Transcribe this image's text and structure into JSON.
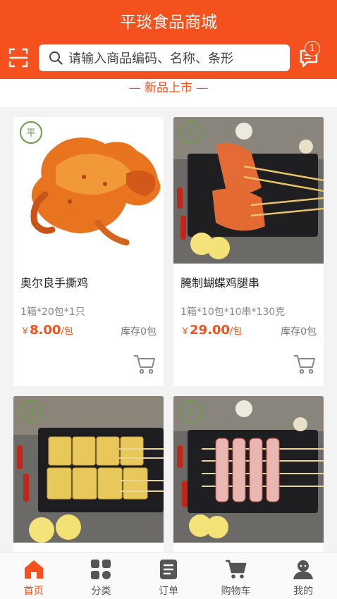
{
  "header": {
    "title": "平琰食品商城",
    "message_badge": "1"
  },
  "search": {
    "placeholder": "请输入商品编码、名称、条形"
  },
  "section": {
    "title": "— 新品上市 —"
  },
  "products": [
    {
      "name": "奥尔良手撕鸡",
      "spec": "1箱*20包*1只",
      "currency": "￥",
      "price": "8.00",
      "unit": "/包",
      "stock": "库存0包"
    },
    {
      "name": "腌制蝴蝶鸡腿串",
      "spec": "1箱*10包*10串*130克",
      "currency": "￥",
      "price": "29.00",
      "unit": "/包",
      "stock": "库存0包"
    },
    {
      "name": "",
      "spec": "",
      "currency": "",
      "price": "",
      "unit": "",
      "stock": ""
    },
    {
      "name": "",
      "spec": "",
      "currency": "",
      "price": "",
      "unit": "",
      "stock": ""
    }
  ],
  "tabs": [
    {
      "label": "首页",
      "icon": "home-icon",
      "active": true
    },
    {
      "label": "分类",
      "icon": "category-icon",
      "active": false
    },
    {
      "label": "订单",
      "icon": "order-icon",
      "active": false
    },
    {
      "label": "购物车",
      "icon": "cart-icon",
      "active": false
    },
    {
      "label": "我的",
      "icon": "profile-icon",
      "active": false
    }
  ],
  "colors": {
    "accent": "#f4511e",
    "background": "#f3f3f3"
  }
}
